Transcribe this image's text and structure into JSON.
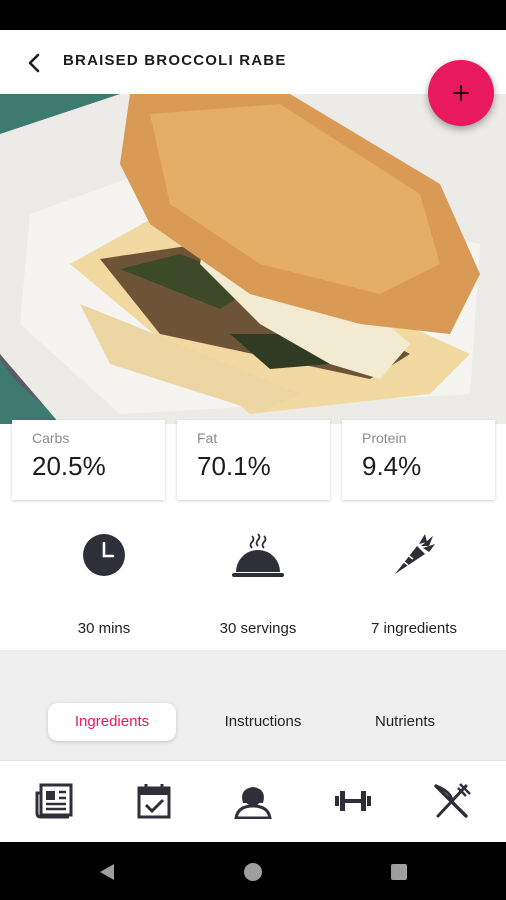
{
  "header": {
    "title": "BRAISED BROCCOLI RABE"
  },
  "macros": [
    {
      "label": "Carbs",
      "value": "20.5%"
    },
    {
      "label": "Fat",
      "value": "70.1%"
    },
    {
      "label": "Protein",
      "value": "9.4%"
    }
  ],
  "stats": {
    "time": "30 mins",
    "servings": "30 servings",
    "ingredients": "7 ingredients"
  },
  "tabs": [
    {
      "label": "Ingredients",
      "active": true
    },
    {
      "label": "Instructions",
      "active": false
    },
    {
      "label": "Nutrients",
      "active": false
    }
  ],
  "colors": {
    "accent": "#e8195f",
    "icon": "#2f2f3a"
  },
  "icons": {
    "back": "arrow-left-icon",
    "fab": "plus-icon",
    "nav": [
      "newspaper-icon",
      "calendar-check-icon",
      "user-icon",
      "dumbbell-icon",
      "fork-knife-icon"
    ]
  }
}
